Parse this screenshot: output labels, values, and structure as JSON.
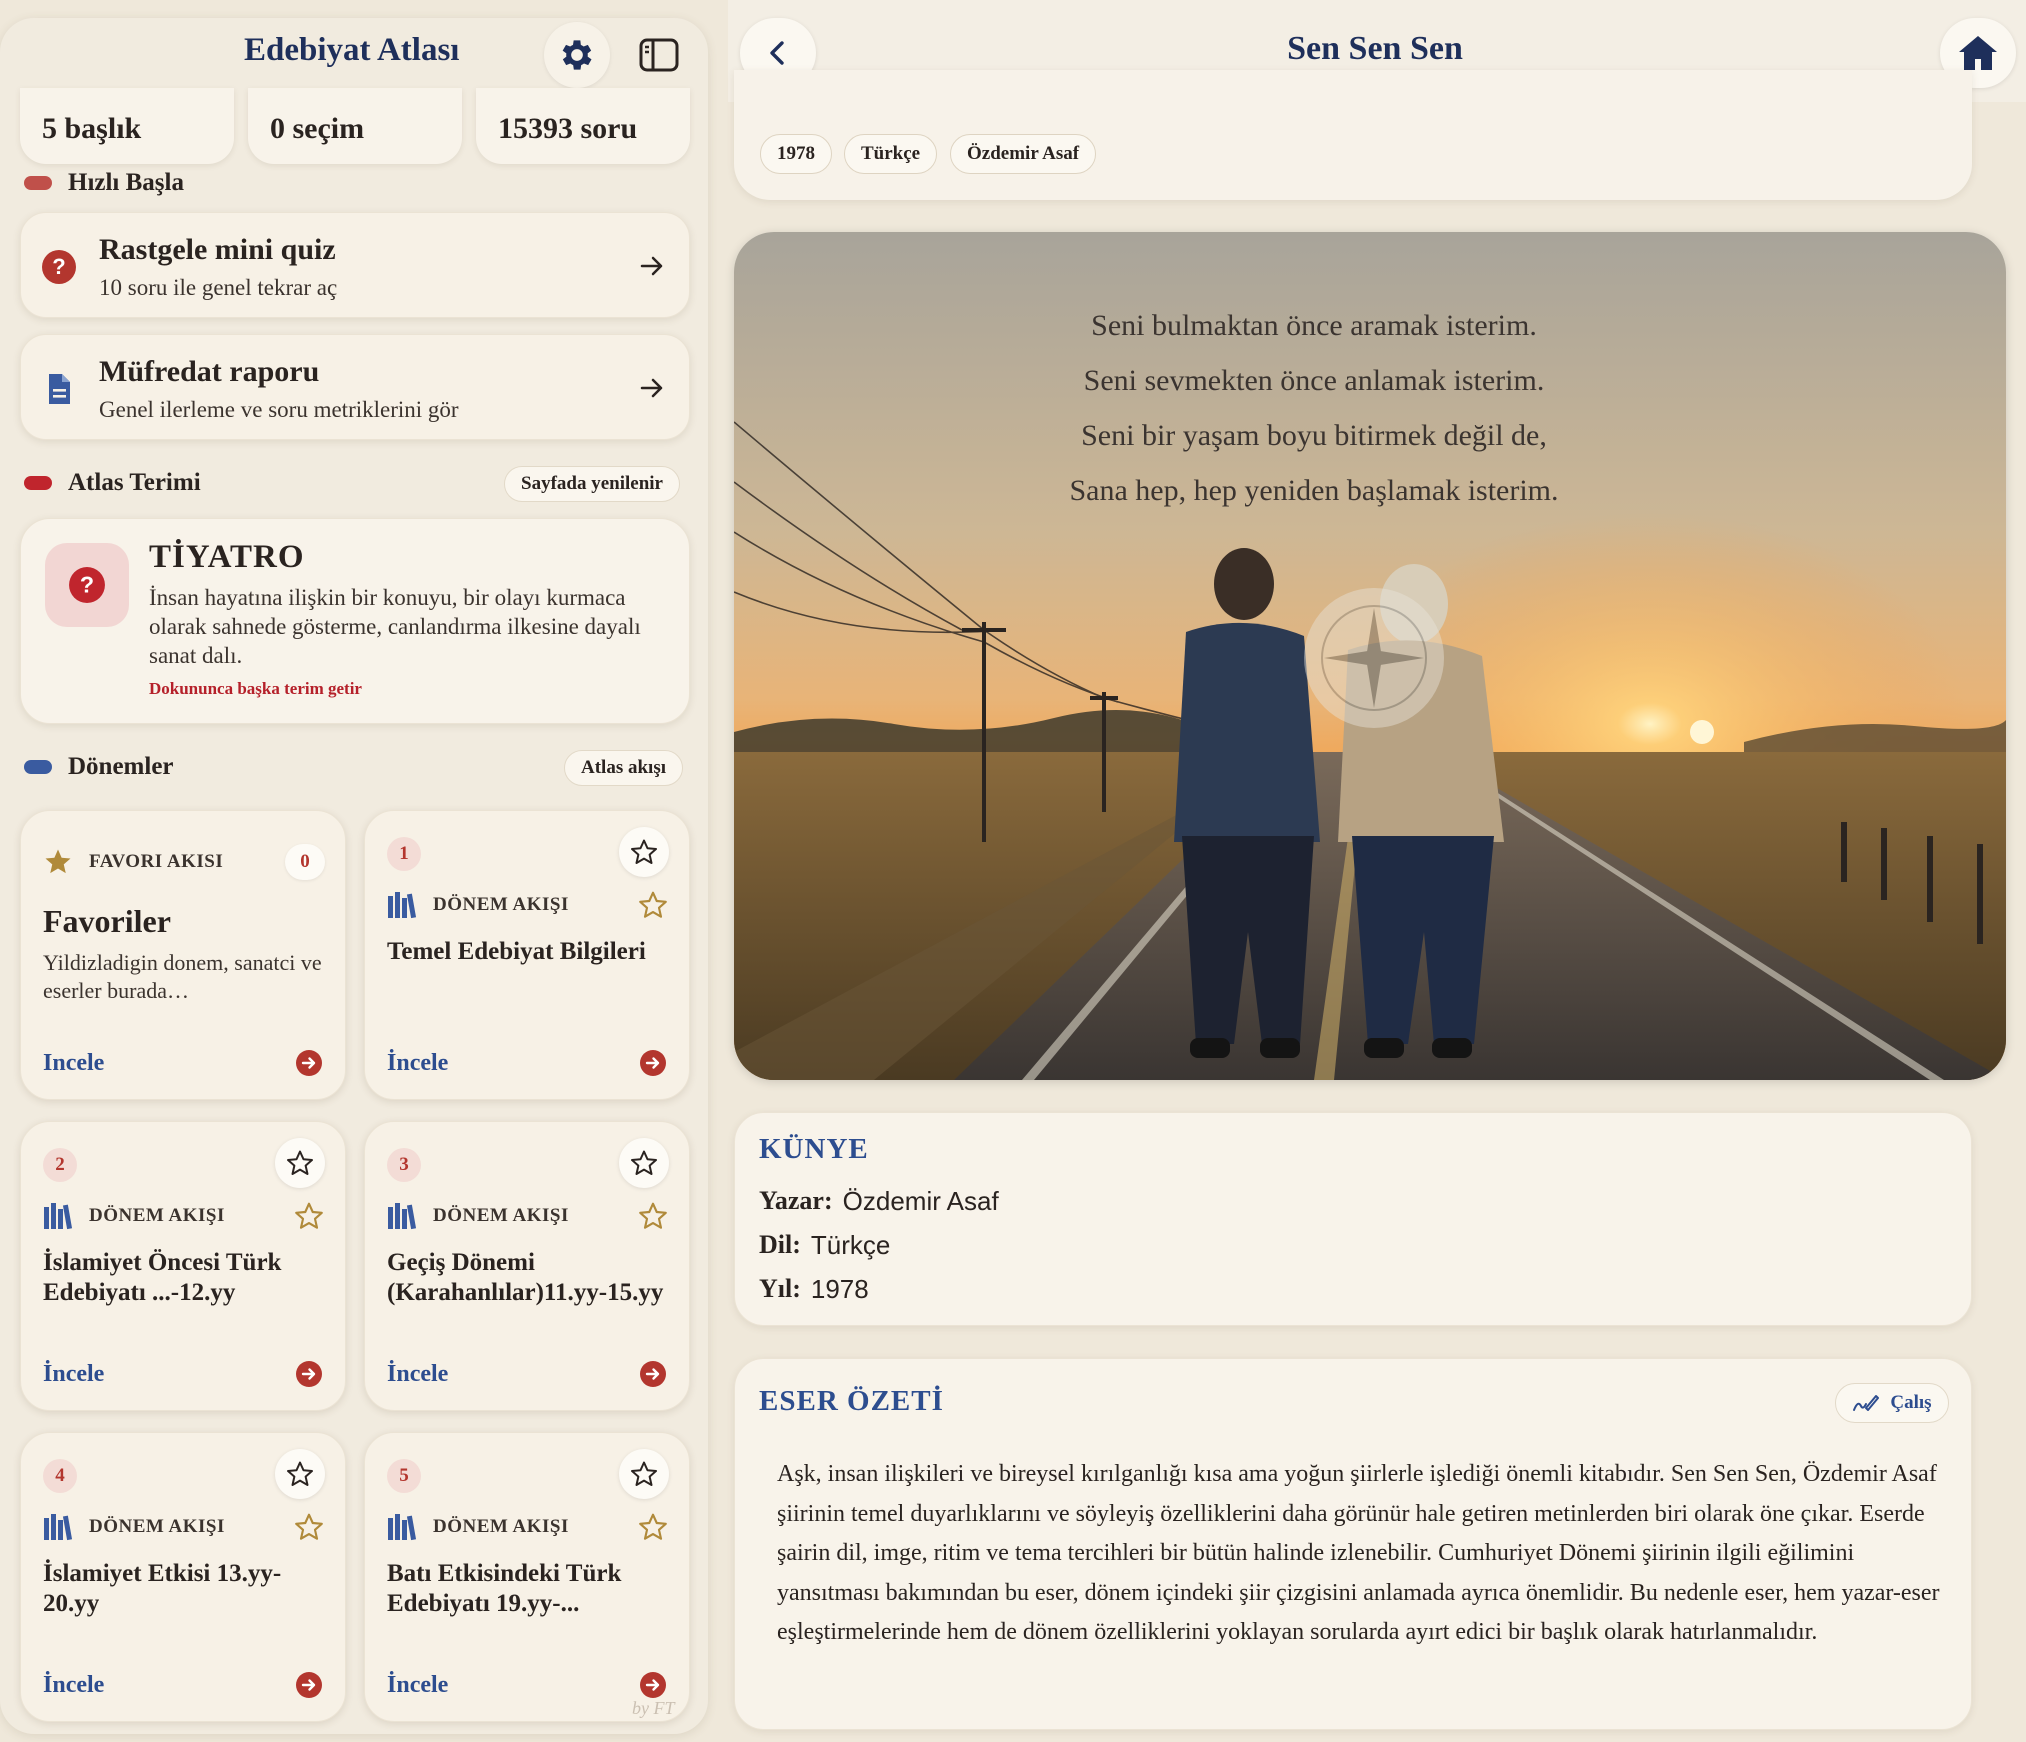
{
  "sidebar": {
    "title": "Edebiyat Atlası",
    "stats": [
      "5 başlık",
      "0 seçim",
      "15393 soru"
    ],
    "quick_start": {
      "heading": "Hızlı Başla",
      "quiz_title": "Rastgele mini quiz",
      "quiz_sub": "10 soru ile genel tekrar aç",
      "report_title": "Müfredat raporu",
      "report_sub": "Genel ilerleme ve soru metriklerini gör"
    },
    "atlas_term": {
      "heading": "Atlas Terimi",
      "refresh_label": "Sayfada yenilenir",
      "term": "TİYATRO",
      "definition": "İnsan hayatına ilişkin bir konuyu, bir olayı kurmaca olarak sahnede gösterme, canlandırma ilkesine dayalı sanat dalı.",
      "hint": "Dokununca başka terim getir"
    },
    "periods": {
      "heading": "Dönemler",
      "flow_label": "Atlas akışı",
      "favorites": {
        "kind": "FAVORI AKISI",
        "count": "0",
        "title": "Favoriler",
        "desc": "Yildizladigin donem, sanatci ve eserler burada…",
        "link": "Incele"
      },
      "items": [
        {
          "num": "1",
          "kind": "DÖNEM AKIŞI",
          "title": "Temel Edebiyat Bilgileri",
          "link": "İncele"
        },
        {
          "num": "2",
          "kind": "DÖNEM AKIŞI",
          "title": "İslamiyet Öncesi Türk Edebiyatı ...-12.yy",
          "link": "İncele"
        },
        {
          "num": "3",
          "kind": "DÖNEM AKIŞI",
          "title": "Geçiş Dönemi (Karahanlılar)11.yy-15.yy",
          "link": "İncele"
        },
        {
          "num": "4",
          "kind": "DÖNEM AKIŞI",
          "title": "İslamiyet Etkisi 13.yy-20.yy",
          "link": "İncele"
        },
        {
          "num": "5",
          "kind": "DÖNEM AKIŞI",
          "title": "Batı Etkisindeki Türk Edebiyatı 19.yy-...",
          "link": "İncele"
        }
      ]
    },
    "watermark": "by FT"
  },
  "main": {
    "title": "Sen Sen Sen",
    "tags": [
      "1978",
      "Türkçe",
      "Özdemir Asaf"
    ],
    "poem": [
      "Seni bulmaktan önce aramak isterim.",
      "Seni sevmekten önce anlamak isterim.",
      "Seni bir yaşam boyu bitirmek değil de,",
      "Sana hep, hep yeniden başlamak isterim."
    ],
    "kunye": {
      "heading": "KÜNYE",
      "rows": [
        {
          "key": "Yazar:",
          "value": "Özdemir Asaf"
        },
        {
          "key": "Dil:",
          "value": "Türkçe"
        },
        {
          "key": "Yıl:",
          "value": "1978"
        }
      ]
    },
    "summary": {
      "heading": "ESER ÖZETİ",
      "study_label": "Çalış",
      "text": "Aşk, insan ilişkileri ve bireysel kırılganlığı kısa ama yoğun şiirlerle işlediği önemli kitabıdır. Sen Sen Sen, Özdemir Asaf şiirinin temel duyarlıklarını ve söyleyiş özelliklerini daha görünür hale getiren metinlerden biri olarak öne çıkar. Eserde şairin dil, imge, ritim ve tema tercihleri bir bütün halinde izlenebilir. Cumhuriyet Dönemi şiirinin ilgili eğilimini yansıtması bakımından bu eser, dönem içindeki şiir çizgisini anlamada ayrıca önemlidir. Bu nedenle eser, hem yazar-eser eşleştirmelerinde hem de dönem özelliklerini yoklayan sorularda ayırt edici bir başlık olarak hatırlanmalıdır."
    }
  },
  "colors": {
    "accent_blue": "#2d4d8f",
    "title_navy": "#1e2f5b",
    "accent_red": "#b5202a",
    "quick_dot": "#c0504a",
    "term_dot": "#c0252d",
    "period_dot": "#3a5ba0"
  }
}
